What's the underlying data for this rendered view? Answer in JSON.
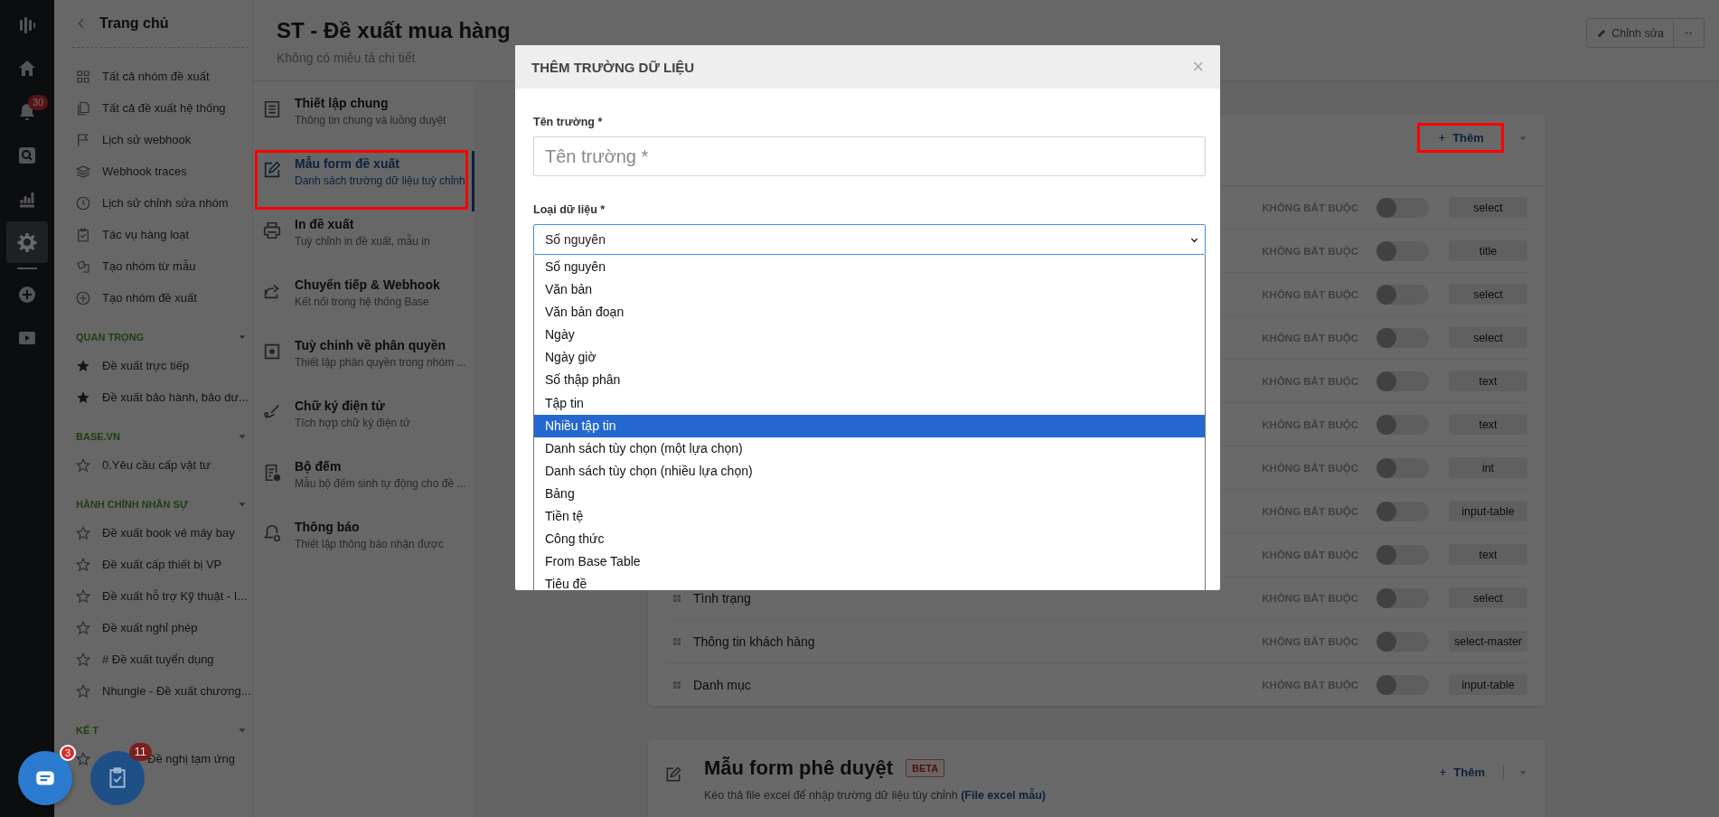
{
  "rail": {
    "items": [
      {
        "kind": "logo",
        "selected": false
      },
      {
        "kind": "home",
        "selected": false
      },
      {
        "kind": "bell",
        "selected": false,
        "badge": "30"
      },
      {
        "kind": "search",
        "selected": false
      },
      {
        "kind": "chart",
        "selected": false
      },
      {
        "kind": "gear",
        "selected": true
      },
      {
        "kind": "plus",
        "selected": false
      },
      {
        "kind": "play",
        "selected": false
      }
    ]
  },
  "sidebar": {
    "back_title": "Trang chủ",
    "items": [
      {
        "kind": "grid",
        "label": "Tất cả nhóm đề xuất"
      },
      {
        "kind": "copy",
        "label": "Tất cả đề xuất hệ thống"
      },
      {
        "kind": "flag",
        "label": "Lịch sử webhook"
      },
      {
        "kind": "layers",
        "label": "Webhook traces"
      },
      {
        "kind": "clock",
        "label": "Lịch sử chỉnh sửa nhóm"
      },
      {
        "kind": "check",
        "label": "Tác vụ hàng loạt"
      },
      {
        "kind": "cards",
        "label": "Tạo nhóm từ mẫu"
      },
      {
        "kind": "plus",
        "label": "Tạo nhóm đề xuất"
      }
    ],
    "sections": [
      {
        "title": "QUAN TRỌNG",
        "items": [
          {
            "label": "Đề xuất trực tiếp",
            "starred": true
          },
          {
            "label": "Đề xuất bảo hành, bảo dư...",
            "starred": true
          }
        ]
      },
      {
        "title": "BASE.VN",
        "items": [
          {
            "label": "0.Yêu cầu cấp vật tư",
            "starred": false
          }
        ]
      },
      {
        "title": "HÀNH CHÍNH NHÂN SỰ",
        "items": [
          {
            "label": "Đề xuất book vé máy bay",
            "starred": false
          },
          {
            "label": "Đề xuất cấp thiết bị VP",
            "starred": false
          },
          {
            "label": "Đề xuất hỗ trợ Kỹ thuật - I...",
            "starred": false
          },
          {
            "label": "Đề xuất nghỉ phép",
            "starred": false
          },
          {
            "label": "# Đề xuất tuyển dụng",
            "starred": false
          },
          {
            "label": "Nhungle - Đề xuất chương...",
            "starred": false
          }
        ]
      },
      {
        "title": "KẾ T",
        "items": [
          {
            "label": "Đề nghị tạm ứng",
            "starred": false
          }
        ]
      }
    ]
  },
  "header": {
    "title": "ST - Đề xuất mua hàng",
    "subtitle": "Không có miêu tả chi tiết",
    "edit_button": "Chỉnh sửa"
  },
  "settings_nav": [
    {
      "kind": "doc",
      "title": "Thiết lập chung",
      "subtitle": "Thông tin chung và luồng duyệt",
      "selected": false,
      "highlighted": false
    },
    {
      "kind": "edit",
      "title": "Mẫu form đề xuất",
      "subtitle": "Danh sách trường dữ liệu tuỳ chỉnh",
      "selected": true,
      "highlighted": true
    },
    {
      "kind": "print",
      "title": "In đề xuất",
      "subtitle": "Tuỳ chỉnh in đề xuất, mẫu in",
      "selected": false,
      "highlighted": false
    },
    {
      "kind": "share",
      "title": "Chuyển tiếp & Webhook",
      "subtitle": "Kết nối trong hệ thống Base",
      "selected": false,
      "highlighted": false
    },
    {
      "kind": "perm",
      "title": "Tuỳ chỉnh về phân quyền",
      "subtitle": "Thiết lập phân quyền trong nhóm ...",
      "selected": false,
      "highlighted": false
    },
    {
      "kind": "sign",
      "title": "Chữ ký điện tử",
      "subtitle": "Tích hợp chữ ký điện tử",
      "selected": false,
      "highlighted": false
    },
    {
      "kind": "counter",
      "title": "Bộ đếm",
      "subtitle": "Mẫu bộ đếm sinh tự động cho đề ...",
      "selected": false,
      "highlighted": false
    },
    {
      "kind": "bell",
      "title": "Thông báo",
      "subtitle": "Thiết lập thông báo nhận được",
      "selected": false,
      "highlighted": false
    }
  ],
  "fields_card": {
    "add_button": "Thêm",
    "add_highlighted": true,
    "rows": [
      {
        "requirement": "KHÔNG BẮT BUỘC",
        "on": false,
        "type": "select"
      },
      {
        "requirement": "KHÔNG BẮT BUỘC",
        "on": false,
        "type": "title"
      },
      {
        "requirement": "KHÔNG BẮT BUỘC",
        "on": false,
        "type": "select"
      },
      {
        "requirement": "KHÔNG BẮT BUỘC",
        "on": false,
        "type": "select"
      },
      {
        "requirement": "KHÔNG BẮT BUỘC",
        "on": false,
        "type": "text"
      },
      {
        "requirement": "KHÔNG BẮT BUỘC",
        "on": false,
        "type": "text"
      },
      {
        "requirement": "KHÔNG BẮT BUỘC",
        "on": false,
        "type": "int"
      },
      {
        "requirement": "KHÔNG BẮT BUỘC",
        "on": false,
        "type": "input-table"
      },
      {
        "requirement": "KHÔNG BẮT BUỘC",
        "on": false,
        "type": "text"
      },
      {
        "name": "Tình trạng",
        "requirement": "KHÔNG BẮT BUỘC",
        "on": false,
        "type": "select"
      },
      {
        "name": "Thông tin khách hàng",
        "requirement": "KHÔNG BẮT BUỘC",
        "on": false,
        "type": "select-master"
      },
      {
        "name": "Danh mục",
        "requirement": "KHÔNG BẮT BUỘC",
        "on": false,
        "type": "input-table"
      }
    ]
  },
  "approval_card": {
    "title": "Mẫu form phê duyệt",
    "badge": "BETA",
    "description": "Kéo thả file excel để nhập trường dữ liệu tùy chỉnh",
    "link": "(File excel mẫu)",
    "add_button": "Thêm"
  },
  "modal": {
    "title": "THÊM TRƯỜNG DỮ LIỆU",
    "close": "×",
    "name_label": "Tên trường *",
    "name_placeholder": "Tên trường *",
    "type_label": "Loại dữ liệu *",
    "type_value": "Số nguyên",
    "options": [
      {
        "label": "Số nguyên",
        "highlighted": false
      },
      {
        "label": "Văn bản",
        "highlighted": false
      },
      {
        "label": "Văn bản đoạn",
        "highlighted": false
      },
      {
        "label": "Ngày",
        "highlighted": false
      },
      {
        "label": "Ngày giờ",
        "highlighted": false
      },
      {
        "label": "Số thập phân",
        "highlighted": false
      },
      {
        "label": "Tập tin",
        "highlighted": false
      },
      {
        "label": "Nhiều tập tin",
        "highlighted": true
      },
      {
        "label": "Danh sách tùy chọn (một lựa chọn)",
        "highlighted": false
      },
      {
        "label": "Danh sách tùy chọn (nhiều lựa chọn)",
        "highlighted": false
      },
      {
        "label": "Bảng",
        "highlighted": false
      },
      {
        "label": "Tiền tệ",
        "highlighted": false
      },
      {
        "label": "Công thức",
        "highlighted": false
      },
      {
        "label": "From Base Table",
        "highlighted": false
      },
      {
        "label": "Tiêu đề",
        "highlighted": false
      }
    ]
  },
  "chat_button": {
    "badge": "3"
  },
  "tasks_button": {
    "badge": "11"
  }
}
